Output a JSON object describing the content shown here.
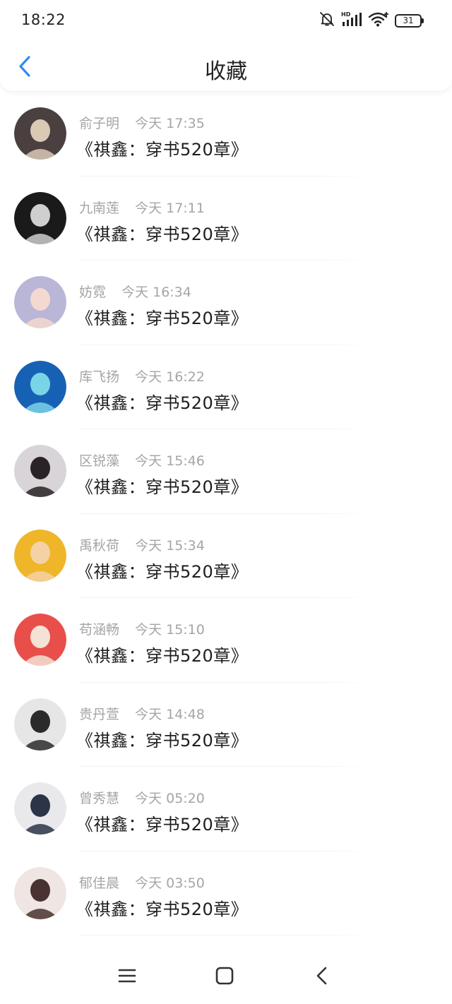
{
  "status": {
    "time": "18:22",
    "battery": "31",
    "icons": [
      "mute-bell-icon",
      "hd-signal-icon",
      "wifi-icon",
      "battery-icon"
    ]
  },
  "header": {
    "back_icon": "chevron-left-icon",
    "title": "收藏"
  },
  "colors": {
    "accent": "#2f8cf0",
    "meta_text": "#a5a5a5",
    "title_text": "#1e1e1e"
  },
  "items": [
    {
      "name": "俞子明",
      "time": "今天 17:35",
      "title": "《祺鑫：穿书520章》",
      "avatar_colors": [
        "#4a4040",
        "#d9c9b5"
      ]
    },
    {
      "name": "九南莲",
      "time": "今天 17:11",
      "title": "《祺鑫：穿书520章》",
      "avatar_colors": [
        "#1a1a1a",
        "#cfcfcf"
      ]
    },
    {
      "name": "妨霓",
      "time": "今天 16:34",
      "title": "《祺鑫：穿书520章》",
      "avatar_colors": [
        "#b9b6d8",
        "#f3d9cf"
      ]
    },
    {
      "name": "库飞扬",
      "time": "今天 16:22",
      "title": "《祺鑫：穿书520章》",
      "avatar_colors": [
        "#1761b5",
        "#7ad4e8"
      ]
    },
    {
      "name": "区锐藻",
      "time": "今天 15:46",
      "title": "《祺鑫：穿书520章》",
      "avatar_colors": [
        "#d8d4d8",
        "#2a2226"
      ]
    },
    {
      "name": "禹秋荷",
      "time": "今天 15:34",
      "title": "《祺鑫：穿书520章》",
      "avatar_colors": [
        "#f0b629",
        "#f5d1a6"
      ]
    },
    {
      "name": "苟涵畅",
      "time": "今天 15:10",
      "title": "《祺鑫：穿书520章》",
      "avatar_colors": [
        "#e94f4a",
        "#f4e2d6"
      ]
    },
    {
      "name": "贵丹萱",
      "time": "今天 14:48",
      "title": "《祺鑫：穿书520章》",
      "avatar_colors": [
        "#e6e6e6",
        "#2b2b2b"
      ]
    },
    {
      "name": "曾秀慧",
      "time": "今天 05:20",
      "title": "《祺鑫：穿书520章》",
      "avatar_colors": [
        "#e9e9ec",
        "#2c3448"
      ]
    },
    {
      "name": "郁佳晨",
      "time": "今天 03:50",
      "title": "《祺鑫：穿书520章》",
      "avatar_colors": [
        "#efe5e3",
        "#4a3230"
      ]
    }
  ],
  "nav": {
    "menu_icon": "menu-icon",
    "home_icon": "home-square-icon",
    "back_icon": "back-triangle-icon"
  }
}
